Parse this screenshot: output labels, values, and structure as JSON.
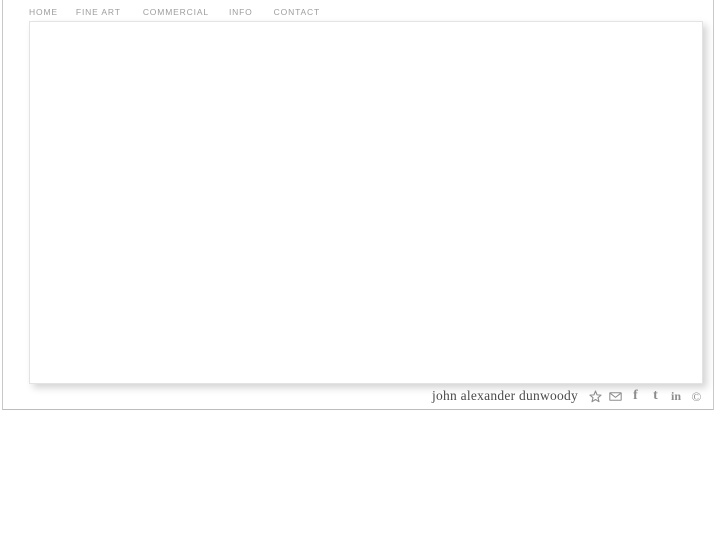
{
  "site": {
    "title": "john alexander dunwoody"
  },
  "nav": {
    "items": [
      {
        "label": "HOME",
        "name": "nav-item-home"
      },
      {
        "label": "FINE ART",
        "name": "nav-item-fine-art"
      },
      {
        "label": "COMMERCIAL",
        "name": "nav-item-commercial"
      },
      {
        "label": "INFO",
        "name": "nav-item-info"
      },
      {
        "label": "CONTACT",
        "name": "nav-item-contact"
      }
    ]
  },
  "content": {
    "body_text": ""
  },
  "footer": {
    "name_text": "john alexander dunwoody",
    "icons": [
      {
        "label": "star",
        "name": "star-icon"
      },
      {
        "label": "email",
        "name": "envelope-icon"
      },
      {
        "label": "facebook",
        "name": "facebook-icon",
        "glyph": "f"
      },
      {
        "label": "twitter",
        "name": "twitter-icon",
        "glyph": "t"
      },
      {
        "label": "linkedin",
        "name": "linkedin-icon",
        "glyph": "in"
      },
      {
        "label": "copyright",
        "name": "copyright-icon",
        "glyph": "©"
      }
    ]
  },
  "colors": {
    "background": "#ffffff",
    "nav_text": "#9d9d9d",
    "footer_text": "#4a4a4a",
    "icon": "#8d8d8d",
    "frame_border": "#c9c9c9",
    "stage_border": "#e3e3e3"
  }
}
